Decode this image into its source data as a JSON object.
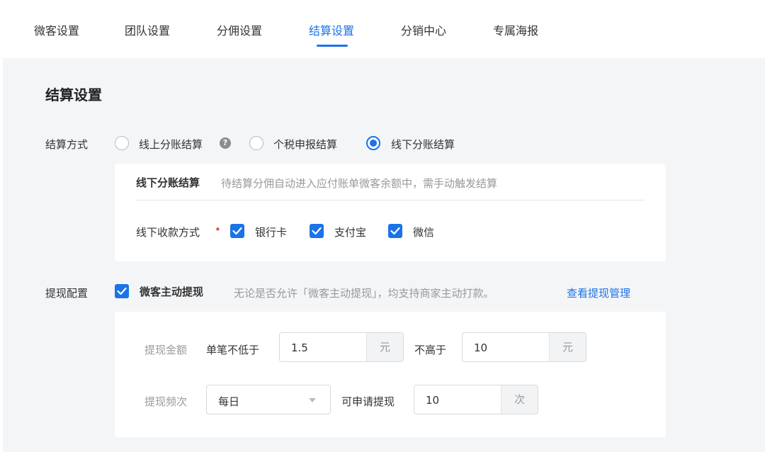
{
  "tabs": [
    {
      "label": "微客设置"
    },
    {
      "label": "团队设置"
    },
    {
      "label": "分佣设置"
    },
    {
      "label": "结算设置"
    },
    {
      "label": "分销中心"
    },
    {
      "label": "专属海报"
    }
  ],
  "active_tab": "结算设置",
  "section_title": "结算设置",
  "settlement": {
    "label": "结算方式",
    "options": [
      {
        "label": "线上分账结算",
        "checked": false,
        "help": "?"
      },
      {
        "label": "个税申报结算",
        "checked": false
      },
      {
        "label": "线下分账结算",
        "checked": true
      }
    ],
    "detail": {
      "title": "线下分账结算",
      "description": "待结算分佣自动进入应付账单微客余额中，需手动触发结算",
      "payment_label": "线下收款方式",
      "payment_methods": [
        {
          "label": "银行卡",
          "checked": true
        },
        {
          "label": "支付宝",
          "checked": true
        },
        {
          "label": "微信",
          "checked": true
        }
      ]
    }
  },
  "withdraw": {
    "label": "提现配置",
    "active_label": "微客主动提现",
    "active_checked": true,
    "note": "无论是否允许「微客主动提现」，均支持商家主动打款。",
    "link": "查看提现管理",
    "amount": {
      "label": "提现金额",
      "min_label": "单笔不低于",
      "min_value": "1.5",
      "min_unit": "元",
      "max_label": "不高于",
      "max_value": "10",
      "max_unit": "元"
    },
    "frequency": {
      "label": "提现频次",
      "period": "每日",
      "count_label": "可申请提现",
      "count_value": "10",
      "count_unit": "次"
    }
  },
  "colors": {
    "accent": "#1a73e8",
    "required": "#e74c3c",
    "background": "#f4f5f7"
  }
}
